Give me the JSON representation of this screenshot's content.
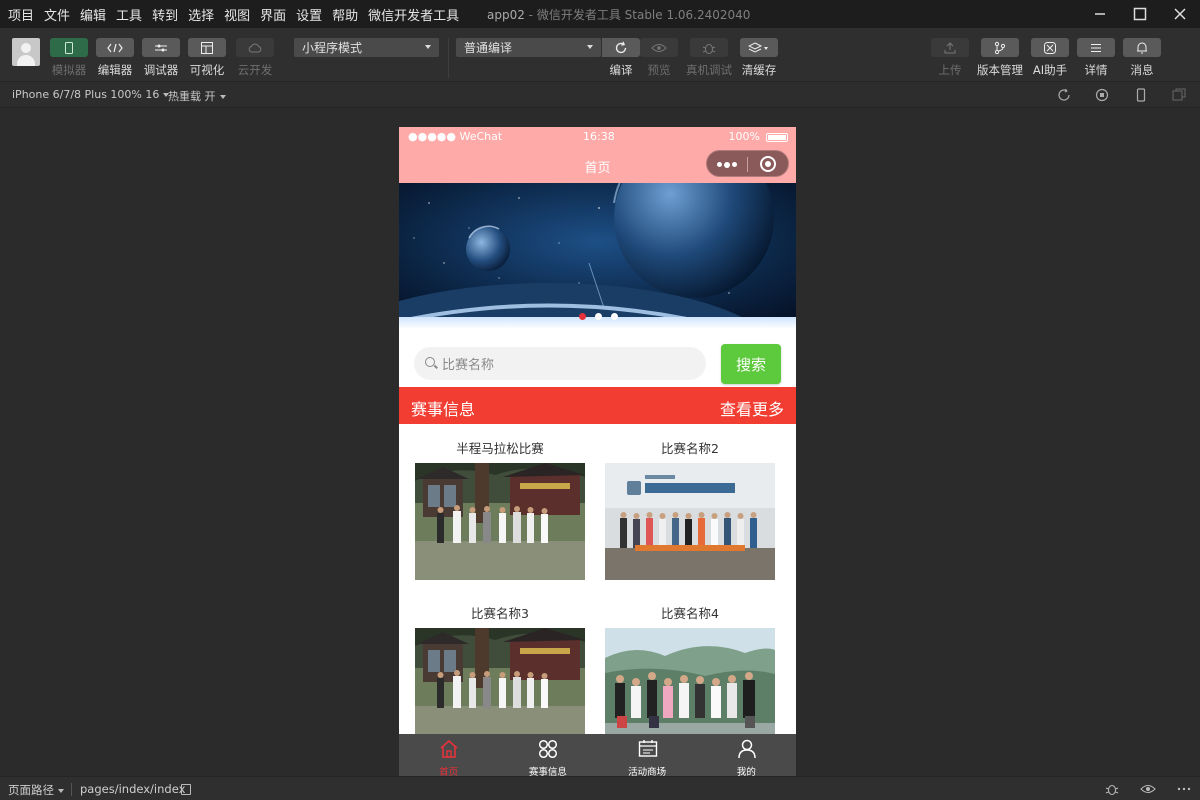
{
  "menubar": {
    "items": [
      "项目",
      "文件",
      "编辑",
      "工具",
      "转到",
      "选择",
      "视图",
      "界面",
      "设置",
      "帮助",
      "微信开发者工具"
    ],
    "title_app": "app02",
    "title_sep": " - ",
    "title_tool": "微信开发者工具 Stable 1.06.2402040"
  },
  "toolbar": {
    "left_buttons": [
      {
        "label": "模拟器",
        "icon": "phone-icon",
        "state": "active"
      },
      {
        "label": "编辑器",
        "icon": "code-icon",
        "state": "normal"
      },
      {
        "label": "调试器",
        "icon": "debug-icon",
        "state": "normal"
      },
      {
        "label": "可视化",
        "icon": "layout-icon",
        "state": "normal"
      },
      {
        "label": "云开发",
        "icon": "cloud-icon",
        "state": "disabled"
      }
    ],
    "mode_select": "小程序模式",
    "compile_select": "普通编译",
    "center_buttons": [
      {
        "label": "编译",
        "icon": "refresh-icon",
        "state": "normal"
      },
      {
        "label": "预览",
        "icon": "eye-icon",
        "state": "disabled"
      },
      {
        "label": "真机调试",
        "icon": "bug-icon",
        "state": "disabled"
      },
      {
        "label": "清缓存",
        "icon": "layers-icon",
        "state": "normal"
      }
    ],
    "right_buttons": [
      {
        "label": "上传",
        "icon": "upload-icon",
        "state": "disabled"
      },
      {
        "label": "版本管理",
        "icon": "branch-icon",
        "state": "normal"
      },
      {
        "label": "AI助手",
        "icon": "ai-icon",
        "state": "normal"
      },
      {
        "label": "详情",
        "icon": "menu-icon",
        "state": "normal"
      },
      {
        "label": "消息",
        "icon": "bell-icon",
        "state": "normal"
      }
    ]
  },
  "subbar": {
    "device": "iPhone 6/7/8 Plus 100% 16",
    "hot_reload": "热重载 开"
  },
  "phone": {
    "status": {
      "carrier": "●●●●● WeChat",
      "time": "16:38",
      "battery": "100%"
    },
    "nav_title": "首页",
    "banner_dots": 3,
    "banner_active_dot": 0,
    "search": {
      "placeholder": "比赛名称",
      "button": "搜索"
    },
    "section": {
      "title": "赛事信息",
      "more": "查看更多"
    },
    "cards": [
      {
        "title": "半程马拉松比赛",
        "photo": "outdoor-group"
      },
      {
        "title": "比赛名称2",
        "photo": "indoor-group"
      },
      {
        "title": "比赛名称3",
        "photo": "outdoor-group"
      },
      {
        "title": "比赛名称4",
        "photo": "mountain-group"
      }
    ],
    "tabs": [
      {
        "label": "首页",
        "icon": "home-icon",
        "active": true
      },
      {
        "label": "赛事信息",
        "icon": "grid-icon",
        "active": false
      },
      {
        "label": "活动商场",
        "icon": "calendar-icon",
        "active": false
      },
      {
        "label": "我的",
        "icon": "user-icon",
        "active": false
      }
    ]
  },
  "bottombar": {
    "path_label": "页面路径",
    "path": "pages/index/index"
  },
  "colors": {
    "nav_pink": "#fdaaa8",
    "section_red": "#f23d32",
    "search_green": "#5dc93c",
    "tab_active": "#e5323a",
    "tabbar_bg": "#4a4a4a"
  }
}
